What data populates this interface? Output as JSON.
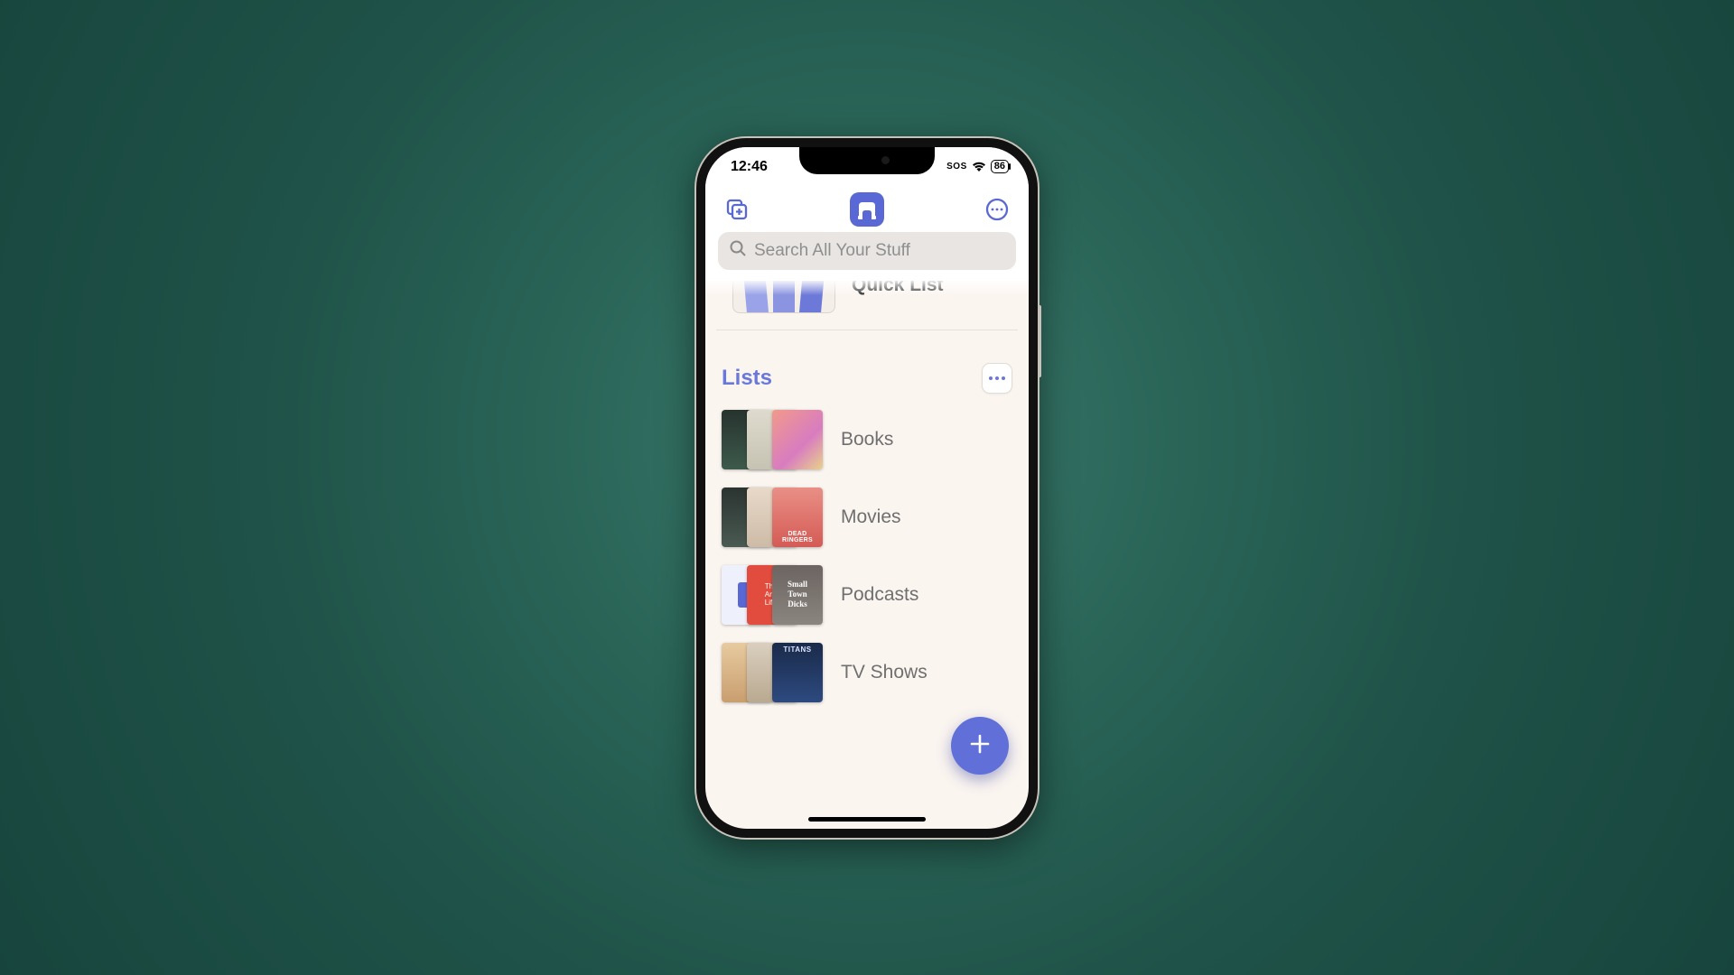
{
  "status": {
    "time": "12:46",
    "sos": "SOS",
    "battery": "86"
  },
  "search": {
    "placeholder": "Search All Your Stuff"
  },
  "quicklist": {
    "label": "Quick List"
  },
  "section": {
    "title": "Lists"
  },
  "lists": {
    "0": {
      "label": "Books"
    },
    "1": {
      "label": "Movies"
    },
    "2": {
      "label": "Podcasts"
    },
    "3": {
      "label": "TV Shows"
    }
  },
  "colors": {
    "accent": "#5968d4",
    "background": "#fbf5f0"
  }
}
